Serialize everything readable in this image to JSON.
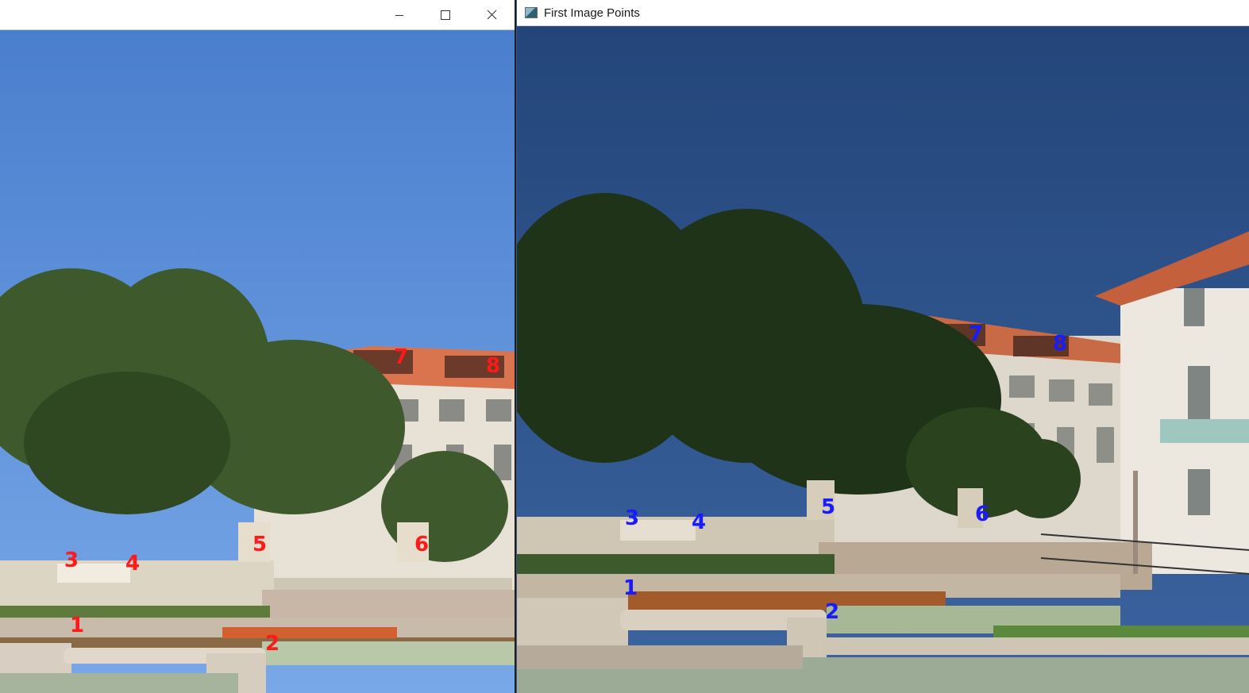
{
  "windows": {
    "left": {
      "title": "",
      "controls": [
        "minimize",
        "maximize",
        "close"
      ],
      "marker_color": "#ff1a1a",
      "markers": [
        "1",
        "2",
        "3",
        "4",
        "5",
        "6",
        "7",
        "8"
      ]
    },
    "right": {
      "title": "First Image Points",
      "icon": "app-window-icon",
      "marker_color": "#1a1aff",
      "markers": [
        "1",
        "2",
        "3",
        "4",
        "5",
        "6",
        "7",
        "8"
      ]
    }
  }
}
